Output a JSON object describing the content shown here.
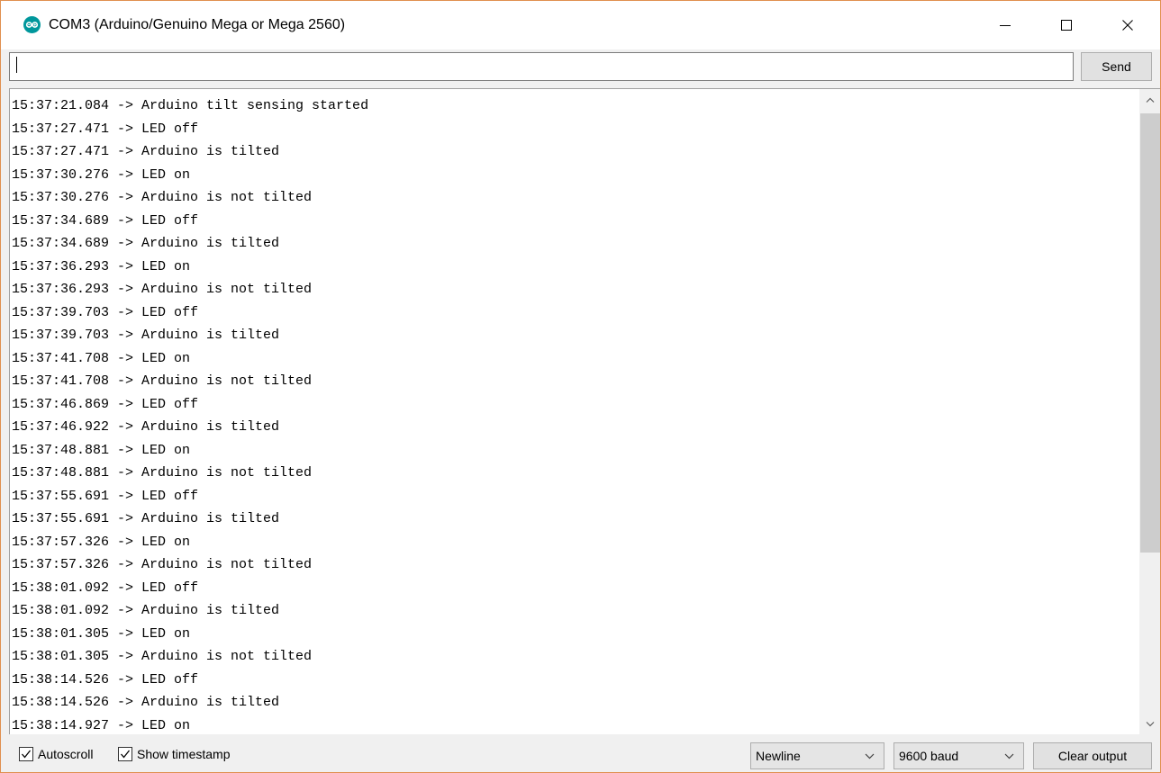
{
  "window": {
    "title": "COM3 (Arduino/Genuino Mega or Mega 2560)",
    "app_icon": "arduino-logo-icon",
    "accent_color": "#00979c",
    "border_color": "#e0904f"
  },
  "input": {
    "value": "",
    "send_label": "Send"
  },
  "output": {
    "lines": [
      "15:37:21.084 -> Arduino tilt sensing started",
      "15:37:27.471 -> LED off",
      "15:37:27.471 -> Arduino is tilted",
      "15:37:30.276 -> LED on",
      "15:37:30.276 -> Arduino is not tilted",
      "15:37:34.689 -> LED off",
      "15:37:34.689 -> Arduino is tilted",
      "15:37:36.293 -> LED on",
      "15:37:36.293 -> Arduino is not tilted",
      "15:37:39.703 -> LED off",
      "15:37:39.703 -> Arduino is tilted",
      "15:37:41.708 -> LED on",
      "15:37:41.708 -> Arduino is not tilted",
      "15:37:46.869 -> LED off",
      "15:37:46.922 -> Arduino is tilted",
      "15:37:48.881 -> LED on",
      "15:37:48.881 -> Arduino is not tilted",
      "15:37:55.691 -> LED off",
      "15:37:55.691 -> Arduino is tilted",
      "15:37:57.326 -> LED on",
      "15:37:57.326 -> Arduino is not tilted",
      "15:38:01.092 -> LED off",
      "15:38:01.092 -> Arduino is tilted",
      "15:38:01.305 -> LED on",
      "15:38:01.305 -> Arduino is not tilted",
      "15:38:14.526 -> LED off",
      "15:38:14.526 -> Arduino is tilted",
      "15:38:14.927 -> LED on"
    ]
  },
  "footer": {
    "autoscroll_label": "Autoscroll",
    "autoscroll_checked": true,
    "timestamp_label": "Show timestamp",
    "timestamp_checked": true,
    "line_ending": "Newline",
    "baud_rate": "9600 baud",
    "clear_label": "Clear output"
  }
}
